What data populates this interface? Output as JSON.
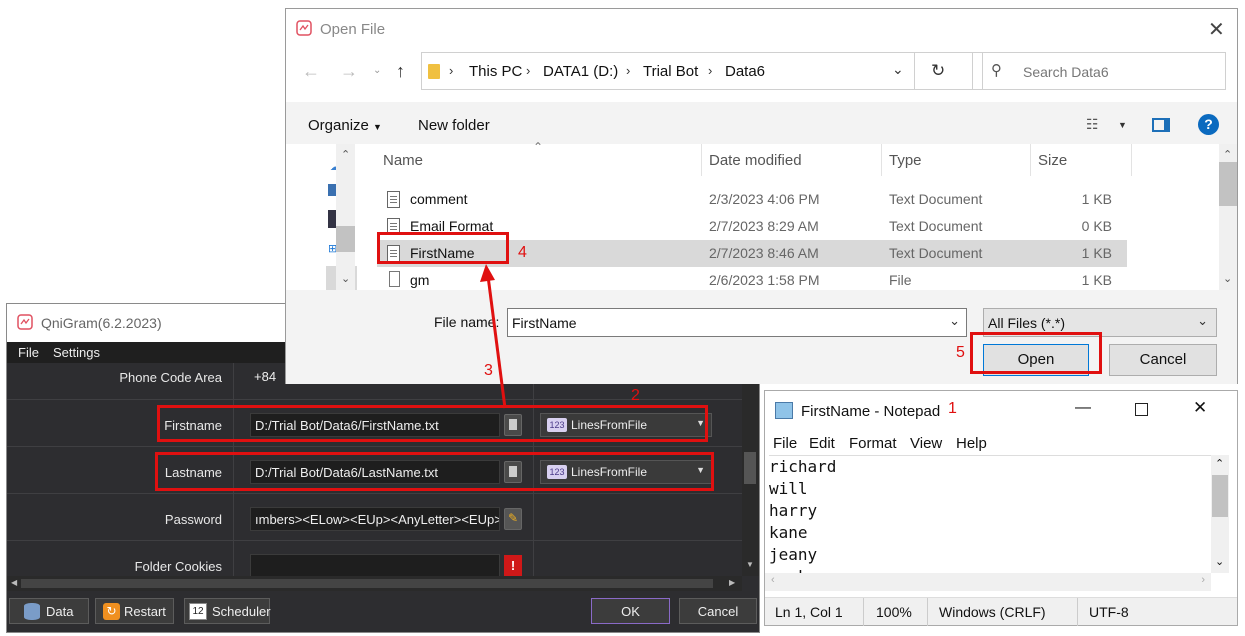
{
  "colors": {
    "annotation_red": "#e01010",
    "dark_bg": "#2d2d30",
    "accent_blue": "#0078d7"
  },
  "qnigram": {
    "title": "QniGram(6.2.2023)",
    "menu": [
      "File",
      "Settings"
    ],
    "rows": {
      "phone_code_area": {
        "label": "Phone Code Area",
        "value": "+84"
      },
      "firstname": {
        "label": "Firstname",
        "value": "D:/Trial Bot/Data6/FirstName.txt",
        "mode": "LinesFromFile"
      },
      "lastname": {
        "label": "Lastname",
        "value": "D:/Trial Bot/Data6/LastName.txt",
        "mode": "LinesFromFile"
      },
      "password": {
        "label": "Password",
        "value": "ımbers><ELow><EUp><AnyLetter><EUp>"
      },
      "folder_cookies": {
        "label": "Folder Cookies",
        "value": ""
      }
    },
    "combo_badge": "123",
    "buttons": {
      "data": "Data",
      "restart": "Restart",
      "scheduler": "Scheduler",
      "ok": "OK",
      "cancel": "Cancel"
    }
  },
  "annotations": [
    "1",
    "2",
    "3",
    "4",
    "5"
  ],
  "open_file": {
    "title": "Open File",
    "breadcrumb": [
      "This PC",
      "DATA1 (D:)",
      "Trial Bot",
      "Data6"
    ],
    "search_placeholder": "Search Data6",
    "toolbar": {
      "organize": "Organize",
      "new_folder": "New folder"
    },
    "columns": [
      "Name",
      "Date modified",
      "Type",
      "Size"
    ],
    "files": [
      {
        "name": "comment",
        "date": "2/3/2023 4:06 PM",
        "type": "Text Document",
        "size": "1 KB"
      },
      {
        "name": "Email Format",
        "date": "2/7/2023 8:29 AM",
        "type": "Text Document",
        "size": "0 KB"
      },
      {
        "name": "FirstName",
        "date": "2/7/2023 8:46 AM",
        "type": "Text Document",
        "size": "1 KB",
        "selected": true
      },
      {
        "name": "gm",
        "date": "2/6/2023 1:58 PM",
        "type": "File",
        "size": "1 KB"
      }
    ],
    "file_name_label": "File name:",
    "file_name_value": "FirstName",
    "filter": "All Files (*.*)",
    "open": "Open",
    "cancel": "Cancel"
  },
  "notepad": {
    "title": "FirstName - Notepad",
    "menu": [
      "File",
      "Edit",
      "Format",
      "View",
      "Help"
    ],
    "lines": [
      "richard",
      "will",
      "harry",
      "kane",
      "jeany",
      "markus"
    ],
    "status": {
      "pos": "Ln 1, Col 1",
      "zoom": "100%",
      "eol": "Windows (CRLF)",
      "enc": "UTF-8"
    }
  }
}
